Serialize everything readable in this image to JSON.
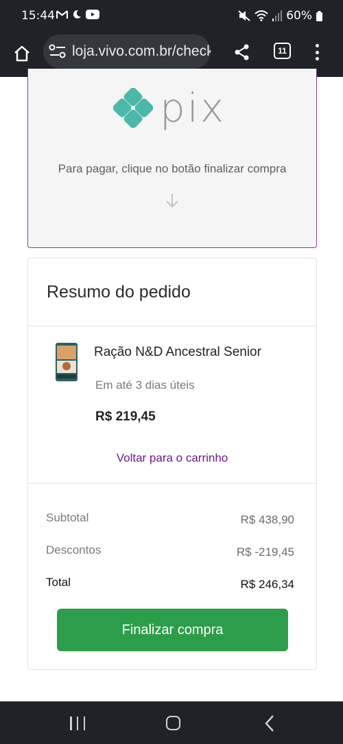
{
  "status_bar": {
    "time": "15:44",
    "battery": "60%",
    "left_icons": [
      "gmail-icon",
      "moon-icon",
      "youtube-icon"
    ],
    "right_icons": [
      "mute-icon",
      "wifi-icon",
      "signal-icon",
      "battery-icon"
    ]
  },
  "browser": {
    "url": "loja.vivo.com.br/checkout",
    "tab_count": "11"
  },
  "pix": {
    "logo_text": "pix",
    "instruction": "Para pagar, clique no botão finalizar compra"
  },
  "summary": {
    "title": "Resumo do pedido",
    "product": {
      "name": "Ração N&D Ancestral Senior",
      "delivery": "Em até 3 dias úteis",
      "price": "R$ 219,45"
    },
    "back_link": "Voltar para o carrinho",
    "subtotal_label": "Subtotal",
    "subtotal_value": "R$ 438,90",
    "discount_label": "Descontos",
    "discount_value": "R$ -219,45",
    "total_label": "Total",
    "total_value": "R$ 246,34",
    "checkout_button": "Finalizar compra"
  },
  "colors": {
    "pix_teal": "#4bb8a9",
    "link_purple": "#6a1b8a",
    "button_green": "#2e9d4b"
  }
}
